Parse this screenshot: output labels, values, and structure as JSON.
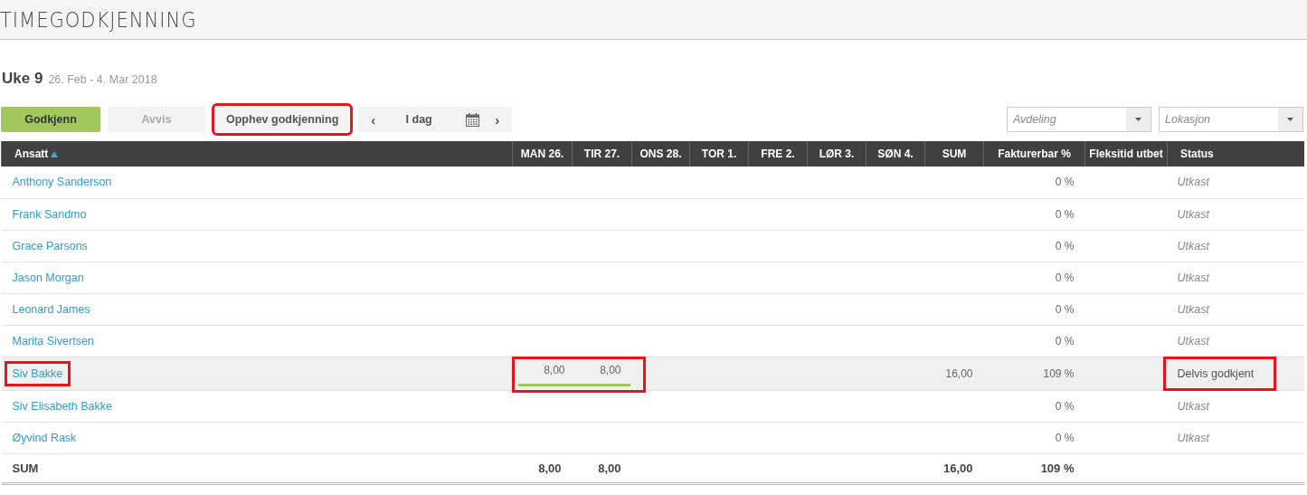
{
  "page_title": "TIMEGODKJENNING",
  "week": {
    "label": "Uke 9",
    "range": "26. Feb - 4. Mar 2018"
  },
  "toolbar": {
    "buttons": [
      {
        "label": "Godkjenn",
        "kind": "primary",
        "disabled": false,
        "highlighted": false
      },
      {
        "label": "Avvis",
        "kind": "plain",
        "disabled": true,
        "highlighted": false
      },
      {
        "label": "Opphev godkjenning",
        "kind": "plain",
        "disabled": false,
        "highlighted": true
      }
    ],
    "nav": {
      "prev": "‹",
      "today": "I dag",
      "next": "›"
    },
    "filters": [
      {
        "placeholder": "Avdeling"
      },
      {
        "placeholder": "Lokasjon"
      }
    ]
  },
  "table": {
    "columns": [
      {
        "label": "Ansatt",
        "sorted": true
      },
      {
        "label": "MAN 26.",
        "sorted": false
      },
      {
        "label": "TIR 27.",
        "sorted": false
      },
      {
        "label": "ONS 28.",
        "sorted": false
      },
      {
        "label": "TOR 1.",
        "sorted": false
      },
      {
        "label": "FRE 2.",
        "sorted": false
      },
      {
        "label": "LØR 3.",
        "sorted": false
      },
      {
        "label": "SØN 4.",
        "sorted": false
      },
      {
        "label": "SUM",
        "sorted": false
      },
      {
        "label": "Fakturerbar %",
        "sorted": false
      },
      {
        "label": "Fleksitid utbet",
        "sorted": false
      },
      {
        "label": "Status",
        "sorted": false
      }
    ],
    "rows": [
      {
        "name": "Anthony Sanderson",
        "selected": false,
        "billable": "0 %",
        "status": "Utkast",
        "status_italic": true,
        "name_highlighted": false,
        "status_highlighted": false
      },
      {
        "name": "Frank Sandmo",
        "selected": false,
        "billable": "0 %",
        "status": "Utkast",
        "status_italic": true,
        "name_highlighted": false,
        "status_highlighted": false
      },
      {
        "name": "Grace Parsons",
        "selected": false,
        "billable": "0 %",
        "status": "Utkast",
        "status_italic": true,
        "name_highlighted": false,
        "status_highlighted": false
      },
      {
        "name": "Jason Morgan",
        "selected": false,
        "billable": "0 %",
        "status": "Utkast",
        "status_italic": true,
        "name_highlighted": false,
        "status_highlighted": false
      },
      {
        "name": "Leonard James",
        "selected": false,
        "billable": "0 %",
        "status": "Utkast",
        "status_italic": true,
        "name_highlighted": false,
        "status_highlighted": false
      },
      {
        "name": "Marita Sivertsen",
        "selected": false,
        "billable": "0 %",
        "status": "Utkast",
        "status_italic": true,
        "name_highlighted": false,
        "status_highlighted": false
      },
      {
        "name": "Siv Bakke",
        "selected": true,
        "hours": [
          "8,00",
          "8,00"
        ],
        "sum": "16,00",
        "billable": "109 %",
        "status": "Delvis godkjent",
        "status_italic": false,
        "approved": true,
        "name_highlighted": true,
        "hours_highlighted": true,
        "status_highlighted": true
      },
      {
        "name": "Siv Elisabeth Bakke",
        "selected": false,
        "billable": "0 %",
        "status": "Utkast",
        "status_italic": true,
        "name_highlighted": false,
        "status_highlighted": false
      },
      {
        "name": "Øyvind Rask",
        "selected": false,
        "billable": "0 %",
        "status": "Utkast",
        "status_italic": true,
        "name_highlighted": false,
        "status_highlighted": false
      }
    ],
    "total": {
      "label": "SUM",
      "hours": [
        "8,00",
        "8,00"
      ],
      "sum": "16,00",
      "billable": "109 %"
    }
  }
}
